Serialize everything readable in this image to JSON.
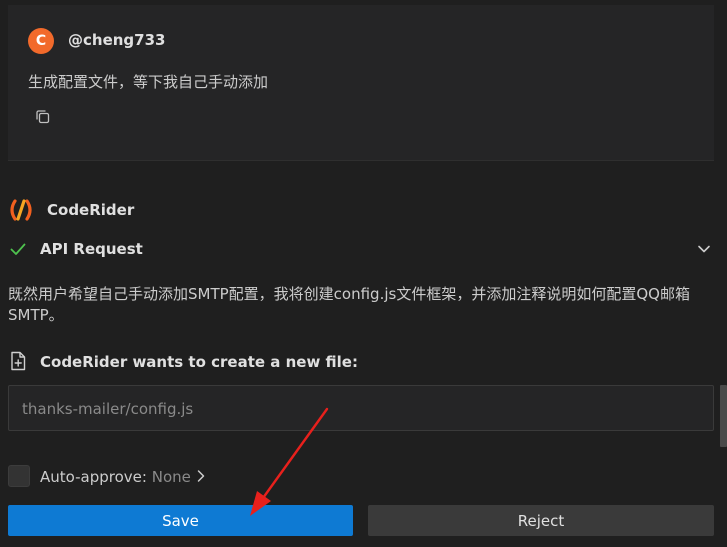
{
  "user_message": {
    "avatar_letter": "C",
    "username": "@cheng733",
    "text": "生成配置文件，等下我自己手动添加",
    "copy_icon": "copy-icon"
  },
  "assistant": {
    "name": "CodeRider",
    "api_request_label": "API Request",
    "description": "既然用户希望自己手动添加SMTP配置，我将创建config.js文件框架，并添加注释说明如何配置QQ邮箱SMTP。",
    "new_file_label": "CodeRider wants to create a new file:",
    "file_path": "thanks-mailer/config.js"
  },
  "auto_approve": {
    "label": "Auto-approve:",
    "value": "None"
  },
  "buttons": {
    "save": "Save",
    "reject": "Reject"
  },
  "colors": {
    "background": "#1f1f1f",
    "accent": "#0e7ad3",
    "avatar": "#f26a2b",
    "success": "#4ec24e",
    "annotation": "#e8201c"
  }
}
